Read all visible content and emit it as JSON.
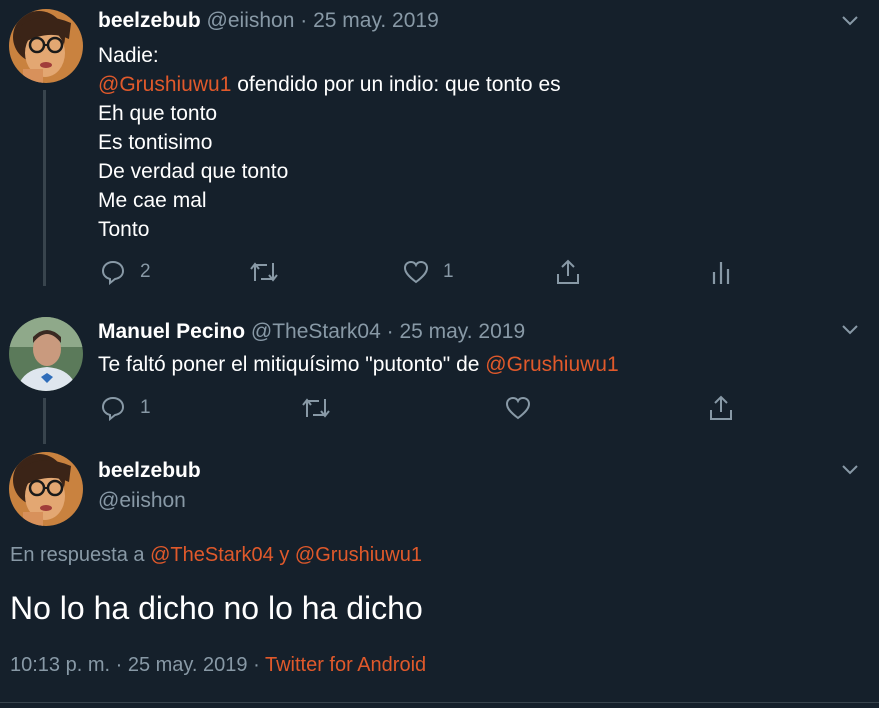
{
  "tweets": [
    {
      "name": "beelzebub",
      "handle": "@eiishon",
      "separator": " · ",
      "date": "25 may. 2019",
      "lines": {
        "l1": "Nadie:",
        "l2_mention": "@Grushiuwu1",
        "l2_rest": " ofendido por un indio: que tonto es",
        "l3": "Eh que tonto",
        "l4": "Es tontisimo",
        "l5": "De verdad que tonto",
        "l6": "Me cae mal",
        "l7": "Tonto"
      },
      "replies": "2",
      "likes": "1"
    },
    {
      "name": "Manuel Pecino",
      "handle": "@TheStark04",
      "separator": " · ",
      "date": "25 may. 2019",
      "text_before": "Te faltó poner el mitiquísimo \"putonto\" de ",
      "text_mention": "@Grushiuwu1",
      "replies": "1"
    }
  ],
  "main_tweet": {
    "name": "beelzebub",
    "handle": "@eiishon",
    "reply_prefix": "En respuesta a ",
    "reply_user1": "@TheStark04",
    "reply_and": " y ",
    "reply_user2": "@Grushiuwu1",
    "text": "No lo ha dicho no lo ha dicho",
    "timestamp": "10:13 p. m. · 25 may. 2019 · ",
    "source": "Twitter for Android"
  },
  "colors": {
    "background": "#15202b",
    "accent": "#e0592b",
    "secondary_text": "#8899a6",
    "divider": "#38444d"
  },
  "icons": [
    "chevron-down-icon",
    "reply-icon",
    "retweet-icon",
    "like-icon",
    "share-icon",
    "analytics-icon"
  ]
}
